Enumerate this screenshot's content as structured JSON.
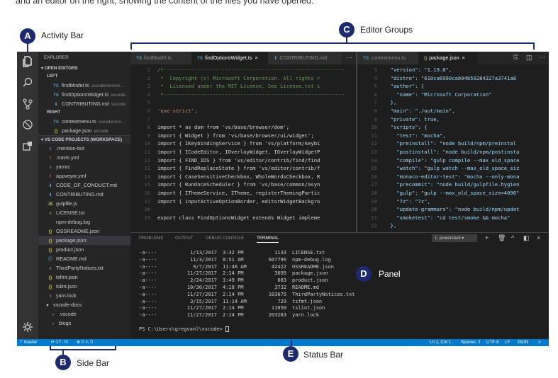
{
  "intro_text": "and an editor on the right, showing the content of the files you have opened.",
  "callouts": {
    "a": {
      "letter": "A",
      "label": "Activity Bar"
    },
    "b": {
      "letter": "B",
      "label": "Side Bar"
    },
    "c": {
      "letter": "C",
      "label": "Editor Groups"
    },
    "d": {
      "letter": "D",
      "label": "Panel"
    },
    "e": {
      "letter": "E",
      "label": "Status Bar"
    }
  },
  "colors": {
    "accent": "#1e2a6e",
    "statusbar": "#007acc",
    "editor_bg": "#1e1e1e"
  },
  "activity_icons": [
    "explorer-icon",
    "search-icon",
    "source-control-icon",
    "debug-icon",
    "extensions-icon",
    "settings-gear-icon"
  ],
  "sidebar": {
    "title": "EXPLORER",
    "open_editors": "OPEN EDITORS",
    "left_label": "LEFT",
    "right_label": "RIGHT",
    "left_files": [
      {
        "icon": "TS",
        "name": "findModel.ts",
        "path": "vscode/src/vs/..."
      },
      {
        "icon": "TS",
        "name": "findOptionsWidget.ts",
        "path": "vscode..."
      },
      {
        "icon": "⬇",
        "name": "CONTRIBUTING.md",
        "path": "vscode"
      }
    ],
    "right_files": [
      {
        "icon": "TS",
        "name": "contextmenu.ts",
        "path": "vscode/src/..."
      },
      {
        "icon": "{}",
        "name": "package.json",
        "path": "vscode"
      }
    ],
    "workspace": "VS CODE PROJECTS (WORKSPACE)",
    "files": [
      {
        "icon": "≡",
        "name": ".mention-bot"
      },
      {
        "icon": "!",
        "name": ".travis.yml"
      },
      {
        "icon": "≡",
        "name": "yarnrc"
      },
      {
        "icon": "!",
        "name": "appveyor.yml"
      },
      {
        "icon": "⬇",
        "name": "CODE_OF_CONDUCT.md"
      },
      {
        "icon": "⬇",
        "name": "CONTRIBUTING.md"
      },
      {
        "icon": "JS",
        "name": "gulpfile.js"
      },
      {
        "icon": "≡",
        "name": "LICENSE.txt"
      },
      {
        "icon": "",
        "name": "npm-debug.log"
      },
      {
        "icon": "{}",
        "name": "OSSREADME.json"
      },
      {
        "icon": "{}",
        "name": "package.json"
      },
      {
        "icon": "{}",
        "name": "product.json"
      },
      {
        "icon": "ⓘ",
        "name": "README.md"
      },
      {
        "icon": "≡",
        "name": "ThirdPartyNotices.txt"
      },
      {
        "icon": "{}",
        "name": "tsfmt.json"
      },
      {
        "icon": "{}",
        "name": "tslint.json"
      },
      {
        "icon": "≡",
        "name": "yarn.lock"
      },
      {
        "icon": "▾",
        "name": "vscode-docs"
      },
      {
        "icon": "›",
        "name": ".vscode"
      },
      {
        "icon": "›",
        "name": "blogs"
      }
    ]
  },
  "left_group": {
    "tabs": [
      {
        "icon": "TS",
        "name": "findModel.ts"
      },
      {
        "icon": "TS",
        "name": "findOptionsWidget.ts",
        "close": "×"
      },
      {
        "icon": "⬇",
        "name": "CONTRIBUTING.md"
      }
    ],
    "more": "···",
    "lines": [
      {
        "n": "1",
        "t": "/*-----------------------------------------------------------",
        "c": "c-com"
      },
      {
        "n": "2",
        "t": " *  Copyright (c) Microsoft Corporation. All rights r",
        "c": "c-com"
      },
      {
        "n": "3",
        "t": " *  Licensed under the MIT License. See License.txt i",
        "c": "c-com"
      },
      {
        "n": "4",
        "t": " *-----------------------------------------------------------",
        "c": "c-com"
      },
      {
        "n": "5",
        "t": "",
        "c": "c-pl"
      },
      {
        "n": "6",
        "t": "'use strict';",
        "c": "c-str"
      },
      {
        "n": "7",
        "t": "",
        "c": "c-pl"
      },
      {
        "n": "8",
        "t": "import * as dom from 'vs/base/browser/dom';",
        "c": "c-pl"
      },
      {
        "n": "9",
        "t": "import { Widget } from 'vs/base/browser/ui/widget';",
        "c": "c-pl"
      },
      {
        "n": "10",
        "t": "import { IKeybindingService } from 'vs/platform/keybi",
        "c": "c-pl"
      },
      {
        "n": "11",
        "t": "import { ICodeEditor, IOverlayWidget, IOverlayWidgetP",
        "c": "c-pl"
      },
      {
        "n": "12",
        "t": "import { FIND_IDS } from 'vs/editor/contrib/find/find",
        "c": "c-pl"
      },
      {
        "n": "13",
        "t": "import { FindReplaceState } from 'vs/editor/contrib/f",
        "c": "c-pl"
      },
      {
        "n": "14",
        "t": "import { CaseSensitiveCheckbox, WholeWordsCheckbox, R",
        "c": "c-pl"
      },
      {
        "n": "15",
        "t": "import { RunOnceScheduler } from 'vs/base/common/asyn",
        "c": "c-pl"
      },
      {
        "n": "16",
        "t": "import { IThemeService, ITheme, registerThemingPartic",
        "c": "c-pl"
      },
      {
        "n": "17",
        "t": "import { inputActiveOptionBorder, editorWidgetBackgro",
        "c": "c-pl"
      },
      {
        "n": "18",
        "t": "",
        "c": "c-pl"
      },
      {
        "n": "19",
        "t": "export class FindOptionsWidget extends Widget impleme",
        "c": "c-pl"
      }
    ]
  },
  "right_group": {
    "tabs": [
      {
        "icon": "TS",
        "name": "contextmenu.ts"
      },
      {
        "icon": "{}",
        "name": "package.json",
        "close": "×"
      }
    ],
    "lines": [
      {
        "n": "3",
        "t": "  \"version\": \"1.19.0\","
      },
      {
        "n": "4",
        "t": "  \"distro\": \"610ca6990cab94b59284327a3741a8"
      },
      {
        "n": "5",
        "t": "  \"author\": {"
      },
      {
        "n": "6",
        "t": "    \"name\": \"Microsoft Corporation\""
      },
      {
        "n": "7",
        "t": "  },"
      },
      {
        "n": "8",
        "t": "  \"main\": \"./out/main\","
      },
      {
        "n": "9",
        "t": "  \"private\": true,"
      },
      {
        "n": "10",
        "t": "  \"scripts\": {"
      },
      {
        "n": "11",
        "t": "    \"test\": \"mocha\","
      },
      {
        "n": "12",
        "t": "    \"preinstall\": \"node build/npm/preinstal"
      },
      {
        "n": "13",
        "t": "    \"postinstall\": \"node build/npm/postinsta"
      },
      {
        "n": "14",
        "t": "    \"compile\": \"gulp compile --max_old_space"
      },
      {
        "n": "15",
        "t": "    \"watch\": \"gulp watch --max_old_space_siz"
      },
      {
        "n": "16",
        "t": "    \"monaco-editor-test\": \"mocha --only-mona"
      },
      {
        "n": "17",
        "t": "    \"precommit\": \"node build/gulpfile.hygien"
      },
      {
        "n": "18",
        "t": "    \"gulp\": \"gulp --max_old_space_size=4096\""
      },
      {
        "n": "19",
        "t": "    \"7z\": \"7z\","
      },
      {
        "n": "20",
        "t": "    \"update-grammars\": \"node build/npm/updat"
      },
      {
        "n": "21",
        "t": "    \"smoketest\": \"cd test/smoke && mocha\""
      },
      {
        "n": "22",
        "t": "  },"
      }
    ]
  },
  "panel": {
    "tabs": [
      "PROBLEMS",
      "OUTPUT",
      "DEBUG CONSOLE",
      "TERMINAL"
    ],
    "terminal_select": "1: powershell",
    "terminal_rows": [
      {
        "mode": "-a----",
        "date": "1/13/2017",
        "time": "3:32 PM",
        "size": "1133",
        "name": "LICENSE.txt"
      },
      {
        "mode": "-a----",
        "date": "11/3/2017",
        "time": "8:51 AM",
        "size": "607796",
        "name": "npm-debug.log"
      },
      {
        "mode": "-a----",
        "date": "9/7/2017",
        "time": "11:46 AM",
        "size": "42422",
        "name": "OSSREADME.json"
      },
      {
        "mode": "-a----",
        "date": "11/27/2017",
        "time": "2:14 PM",
        "size": "3699",
        "name": "package.json"
      },
      {
        "mode": "-a----",
        "date": "2/24/2017",
        "time": "3:49 PM",
        "size": "683",
        "name": "product.json"
      },
      {
        "mode": "-a----",
        "date": "10/30/2017",
        "time": "4:18 PM",
        "size": "3732",
        "name": "README.md"
      },
      {
        "mode": "-a----",
        "date": "11/27/2017",
        "time": "2:14 PM",
        "size": "103675",
        "name": "ThirdPartyNotices.txt"
      },
      {
        "mode": "-a----",
        "date": "3/15/2017",
        "time": "11:14 AM",
        "size": "729",
        "name": "tsfmt.json"
      },
      {
        "mode": "-a----",
        "date": "11/27/2017",
        "time": "2:14 PM",
        "size": "11050",
        "name": "tslint.json"
      },
      {
        "mode": "-a----",
        "date": "11/27/2017",
        "time": "2:14 PM",
        "size": "203283",
        "name": "yarn.lock"
      }
    ],
    "prompt": "PS C:\\Users\\gregvanl\\vscode> "
  },
  "statusbar": {
    "branch": "master",
    "sync": "17↓ 0↑",
    "problems": "⊗ 0 ⚠ 0",
    "position": "Ln 1, Col 1",
    "spaces": "Spaces: 2",
    "encoding": "UTF-8",
    "eol": "LF",
    "language": "JSON",
    "smiley": "☺"
  }
}
